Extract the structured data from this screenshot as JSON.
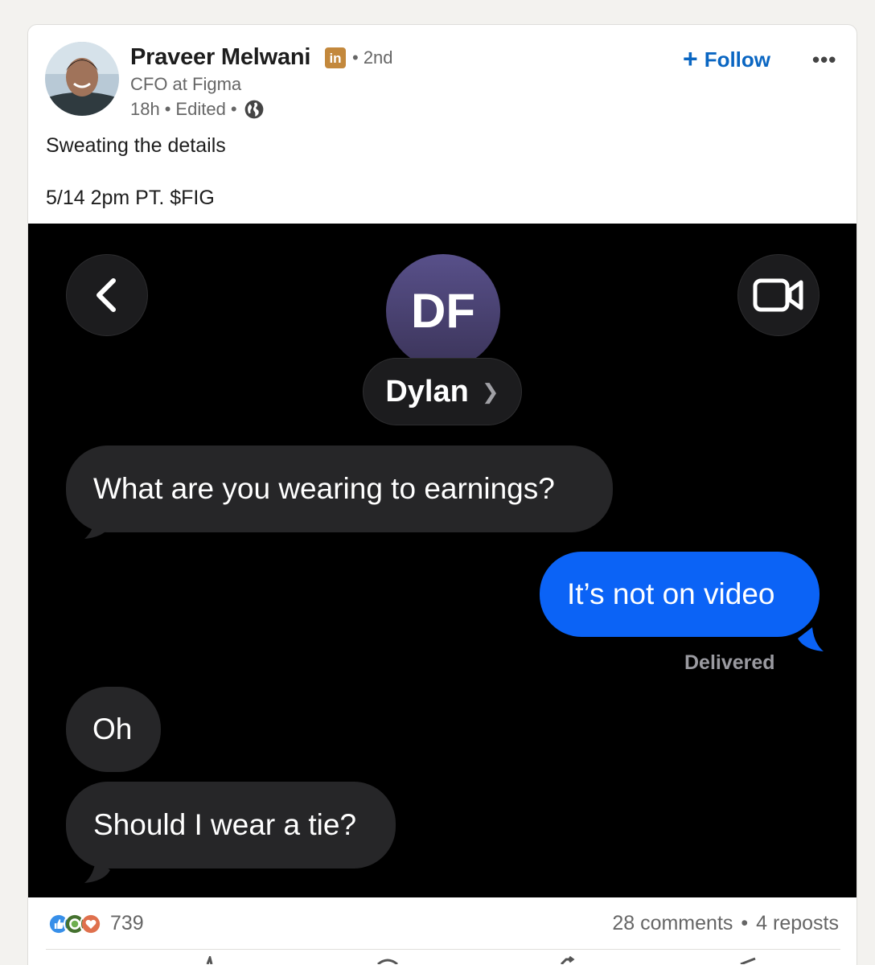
{
  "author": {
    "name": "Praveer Melwani",
    "badge": "in",
    "degree": "• 2nd",
    "headline": "CFO at Figma",
    "time": "18h",
    "edited": "Edited"
  },
  "actions": {
    "follow_label": "Follow",
    "more_label": "•••"
  },
  "post": {
    "line1": "Sweating the details",
    "line2": "5/14 2pm PT. $FIG"
  },
  "screenshot": {
    "contact_initials": "DF",
    "contact_name": "Dylan",
    "messages": [
      {
        "from": "them",
        "text": "What are you wearing to earnings?"
      },
      {
        "from": "me",
        "text": "It’s not on video"
      },
      {
        "from": "them",
        "text": "Oh"
      },
      {
        "from": "them",
        "text": "Should I wear a tie?"
      }
    ],
    "status": "Delivered"
  },
  "stats": {
    "reaction_count": "739",
    "comments": "28 comments",
    "separator": "•",
    "reposts": "4 reposts"
  },
  "colors": {
    "link_blue": "#0a66c2",
    "imessage_blue": "#0b63f6",
    "incoming_bubble": "#262628",
    "linkedin_badge": "#c3883c"
  },
  "icons": [
    "plus-icon",
    "more-icon",
    "globe-icon",
    "back-chevron-icon",
    "video-camera-icon",
    "chevron-right-icon",
    "like-reaction-icon",
    "celebrate-reaction-icon",
    "love-reaction-icon"
  ]
}
